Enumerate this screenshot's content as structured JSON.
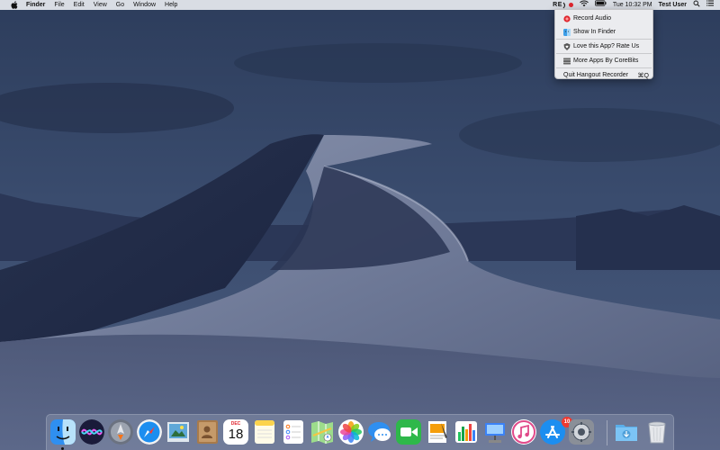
{
  "menubar": {
    "app_name": "Finder",
    "menus": [
      "File",
      "Edit",
      "View",
      "Go",
      "Window",
      "Help"
    ],
    "status": {
      "rec_label": "RE",
      "clock": "Tue 10:32 PM",
      "user": "Test User"
    }
  },
  "dropdown": {
    "items": [
      {
        "label": "Record Audio",
        "icon": "record-icon"
      },
      {
        "label": "Show In Finder",
        "icon": "finder-icon"
      },
      {
        "label": "Love this App? Rate Us",
        "icon": "heart-shield-icon"
      },
      {
        "label": "More Apps By CoreBits",
        "icon": "stack-icon"
      },
      {
        "label": "Quit Hangout Recorder",
        "shortcut": "⌘Q"
      }
    ]
  },
  "dock": {
    "apps": [
      {
        "name": "Finder",
        "icon": "finder-icon"
      },
      {
        "name": "Siri",
        "icon": "siri-icon"
      },
      {
        "name": "Launchpad",
        "icon": "launchpad-icon"
      },
      {
        "name": "Safari",
        "icon": "safari-icon"
      },
      {
        "name": "Preview",
        "icon": "preview-icon"
      },
      {
        "name": "Contacts",
        "icon": "contacts-icon"
      },
      {
        "name": "Calendar",
        "icon": "calendar-icon"
      },
      {
        "name": "Notes",
        "icon": "notes-icon"
      },
      {
        "name": "Reminders",
        "icon": "reminders-icon"
      },
      {
        "name": "Maps",
        "icon": "maps-icon"
      },
      {
        "name": "Photos",
        "icon": "photos-icon"
      },
      {
        "name": "Messages",
        "icon": "messages-icon"
      },
      {
        "name": "FaceTime",
        "icon": "facetime-icon"
      },
      {
        "name": "Pages",
        "icon": "pages-icon"
      },
      {
        "name": "Numbers",
        "icon": "numbers-icon"
      },
      {
        "name": "Keynote",
        "icon": "keynote-icon"
      },
      {
        "name": "iTunes",
        "icon": "itunes-icon"
      },
      {
        "name": "App Store",
        "icon": "app-store-icon"
      },
      {
        "name": "System Preferences",
        "icon": "system-preferences-icon"
      },
      {
        "name": "Downloads",
        "icon": "downloads-folder-icon"
      },
      {
        "name": "Trash",
        "icon": "trash-icon"
      }
    ],
    "calendar_month": "DEC",
    "calendar_day": "18",
    "app_store_badge": "10"
  },
  "colors": {
    "accent_red": "#e0252e",
    "menubar_bg": "#e8eaf0"
  }
}
